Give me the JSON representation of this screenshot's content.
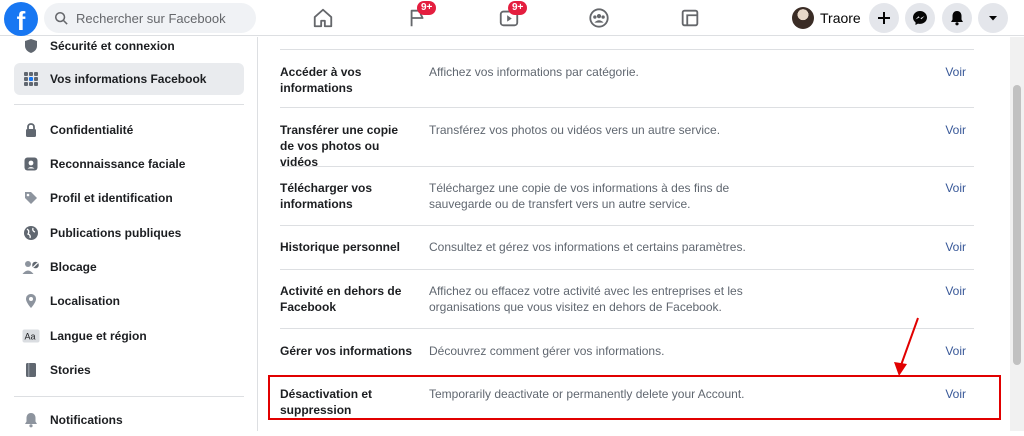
{
  "topbar": {
    "logo_letter": "f",
    "search": {
      "placeholder": "Rechercher sur Facebook"
    },
    "badges": {
      "pages": "9+",
      "watch": "9+"
    },
    "profile_name": "Traore"
  },
  "sidebar": {
    "items": [
      {
        "label": "Sécurité et connexion",
        "icon": "shield-icon"
      },
      {
        "label": "Vos informations Facebook",
        "icon": "grid-icon",
        "active": true
      },
      {
        "label": "Confidentialité",
        "icon": "lock-icon"
      },
      {
        "label": "Reconnaissance faciale",
        "icon": "face-icon"
      },
      {
        "label": "Profil et identification",
        "icon": "tag-icon"
      },
      {
        "label": "Publications publiques",
        "icon": "globe-icon"
      },
      {
        "label": "Blocage",
        "icon": "block-user-icon"
      },
      {
        "label": "Localisation",
        "icon": "location-pin-icon"
      },
      {
        "label": "Langue et région",
        "icon": "language-icon"
      },
      {
        "label": "Stories",
        "icon": "book-icon"
      },
      {
        "label": "Notifications",
        "icon": "bell-icon"
      }
    ]
  },
  "main": {
    "rows": [
      {
        "title": "Accéder à vos informations",
        "desc": "Affichez vos informations par catégorie.",
        "link": "Voir"
      },
      {
        "title": "Transférer une copie de vos photos ou vidéos",
        "desc": "Transférez vos photos ou vidéos vers un autre service.",
        "link": "Voir"
      },
      {
        "title": "Télécharger vos informations",
        "desc": "Téléchargez une copie de vos informations à des fins de sauvegarde ou de transfert vers un autre service.",
        "link": "Voir"
      },
      {
        "title": "Historique personnel",
        "desc": "Consultez et gérez vos informations et certains paramètres.",
        "link": "Voir"
      },
      {
        "title": "Activité en dehors de Facebook",
        "desc": "Affichez ou effacez votre activité avec les entreprises et les organisations que vous visitez en dehors de Facebook.",
        "link": "Voir"
      },
      {
        "title": "Gérer vos informations",
        "desc": "Découvrez comment gérer vos informations.",
        "link": "Voir"
      },
      {
        "title": "Désactivation et suppression",
        "desc": "Temporarily deactivate or permanently delete your Account.",
        "link": "Voir"
      }
    ]
  },
  "colors": {
    "brand": "#1877f2",
    "link": "#385898",
    "highlight": "#e10000",
    "badge": "#e41e3f"
  }
}
